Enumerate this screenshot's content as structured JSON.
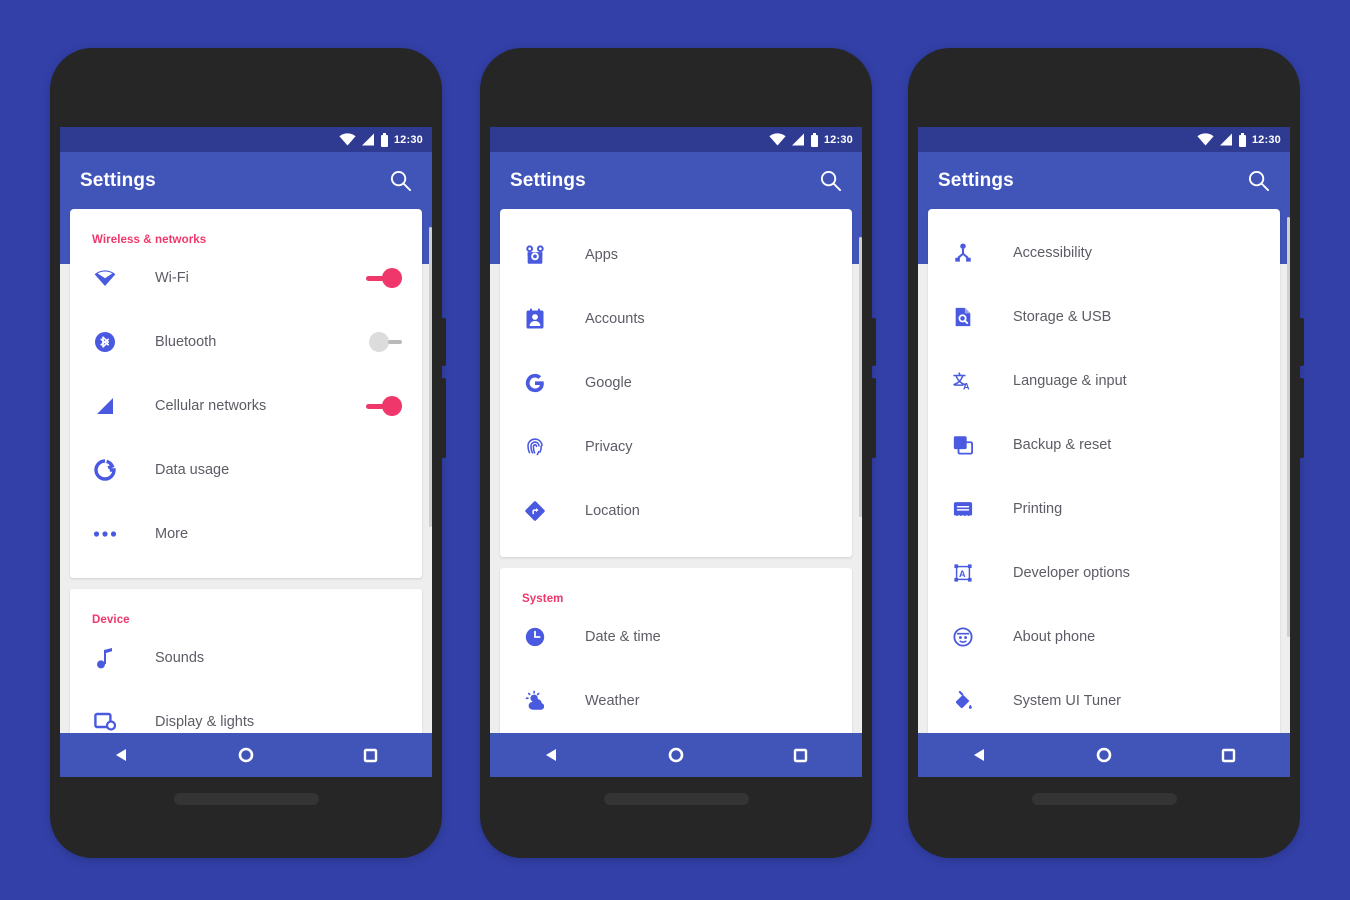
{
  "background_color": "#3340a8",
  "colors": {
    "status_bar": "#2f3a91",
    "app_bar": "#4155b8",
    "accent_pink": "#f0376b",
    "icon_blue": "#4a5ae0",
    "card": "#ffffff",
    "page": "#eeeeee",
    "text": "#5c5c66"
  },
  "status_bar": {
    "time": "12:30",
    "icons": [
      "wifi-icon",
      "cellular-signal-icon",
      "battery-icon"
    ]
  },
  "app_bar": {
    "title": "Settings",
    "search_icon": "search-icon"
  },
  "nav_bar": {
    "back": "back-triangle-icon",
    "home": "home-circle-icon",
    "recents": "recents-square-icon"
  },
  "phones": [
    {
      "id": "phone-1",
      "cards": [
        {
          "section": "Wireless & networks",
          "rows": [
            {
              "icon": "wifi-icon",
              "label": "Wi-Fi",
              "toggle": "on"
            },
            {
              "icon": "bluetooth-icon",
              "label": "Bluetooth",
              "toggle": "off"
            },
            {
              "icon": "cellular-signal-icon",
              "label": "Cellular networks",
              "toggle": "on"
            },
            {
              "icon": "data-usage-icon",
              "label": "Data usage",
              "toggle": null
            },
            {
              "icon": "more-dots-icon",
              "label": "More",
              "toggle": null
            }
          ]
        },
        {
          "section": "Device",
          "rows": [
            {
              "icon": "music-note-icon",
              "label": "Sounds",
              "toggle": null
            },
            {
              "icon": "display-icon",
              "label": "Display & lights",
              "toggle": null
            }
          ]
        }
      ]
    },
    {
      "id": "phone-2",
      "cards": [
        {
          "section": null,
          "rows": [
            {
              "icon": "apps-icon",
              "label": "Apps",
              "toggle": null
            },
            {
              "icon": "accounts-icon",
              "label": "Accounts",
              "toggle": null
            },
            {
              "icon": "google-g-icon",
              "label": "Google",
              "toggle": null
            },
            {
              "icon": "fingerprint-icon",
              "label": "Privacy",
              "toggle": null
            },
            {
              "icon": "location-icon",
              "label": "Location",
              "toggle": null
            }
          ]
        },
        {
          "section": "System",
          "rows": [
            {
              "icon": "clock-icon",
              "label": "Date & time",
              "toggle": null
            },
            {
              "icon": "weather-icon",
              "label": "Weather",
              "toggle": null
            }
          ]
        }
      ]
    },
    {
      "id": "phone-3",
      "cards": [
        {
          "section": null,
          "rows": [
            {
              "icon": "accessibility-icon",
              "label": "Accessibility",
              "toggle": null
            },
            {
              "icon": "storage-icon",
              "label": "Storage & USB",
              "toggle": null
            },
            {
              "icon": "language-icon",
              "label": "Language & input",
              "toggle": null
            },
            {
              "icon": "backup-icon",
              "label": "Backup & reset",
              "toggle": null
            },
            {
              "icon": "printing-icon",
              "label": "Printing",
              "toggle": null
            },
            {
              "icon": "developer-options-icon",
              "label": "Developer options",
              "toggle": null
            },
            {
              "icon": "about-phone-icon",
              "label": "About phone",
              "toggle": null
            },
            {
              "icon": "system-ui-tuner-icon",
              "label": "System UI Tuner",
              "toggle": null
            }
          ]
        }
      ]
    }
  ]
}
